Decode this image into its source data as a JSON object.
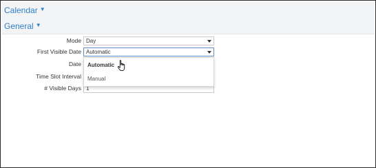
{
  "sections": {
    "calendar": {
      "label": "Calendar"
    },
    "general": {
      "label": "General"
    }
  },
  "form": {
    "mode": {
      "label": "Mode",
      "value": "Day"
    },
    "first_visible_date": {
      "label": "First Visible Date",
      "value": "Automatic"
    },
    "date": {
      "label": "Date",
      "value": ""
    },
    "time_slot_interval": {
      "label": "Time Slot Interval",
      "value": ""
    },
    "visible_days": {
      "label": "# Visible Days",
      "value": "1"
    }
  },
  "dropdown": {
    "options": [
      {
        "label": "Automatic",
        "selected": true
      },
      {
        "label": "Manual",
        "selected": false
      }
    ]
  },
  "icons": {
    "expand": "triangle-down-icon",
    "select_arrow": "chevron-down-icon",
    "cursor": "hand-pointer-icon"
  },
  "colors": {
    "header_text": "#2f7ec8",
    "header_bg": "#f3f4f6",
    "focus_border": "#5b8fcb"
  }
}
